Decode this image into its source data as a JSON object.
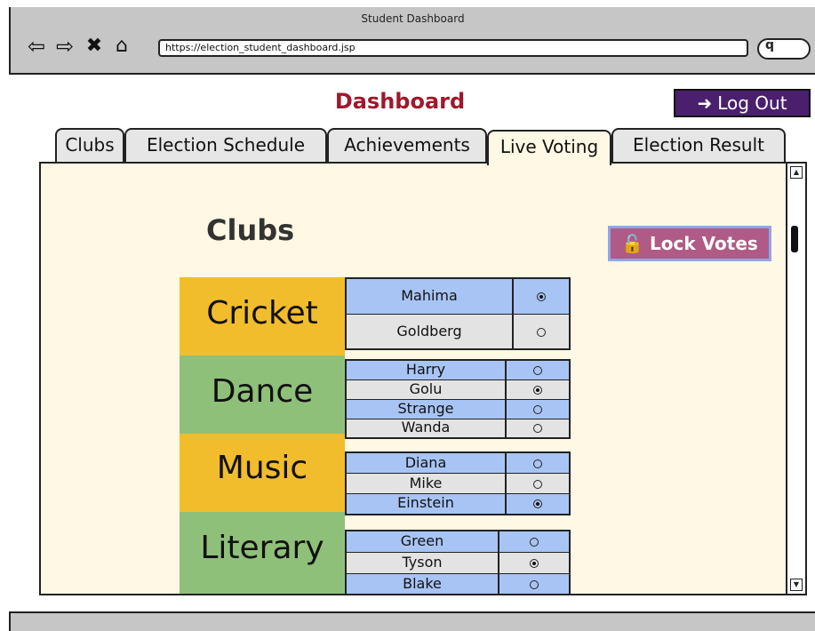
{
  "window": {
    "title": "Student Dashboard",
    "url": "https://election_student_dashboard.jsp"
  },
  "header": {
    "title": "Dashboard",
    "logout_label": "Log Out"
  },
  "tabs": [
    {
      "label": "Clubs"
    },
    {
      "label": "Election Schedule"
    },
    {
      "label": "Achievements"
    },
    {
      "label": "Live Voting",
      "active": true
    },
    {
      "label": "Election Result"
    }
  ],
  "main": {
    "section_title": "Clubs",
    "lock_label": "Lock Votes",
    "clubs": [
      {
        "name": "Cricket",
        "color": "#f2bd2c",
        "candidates": [
          {
            "name": "Mahima",
            "selected": true
          },
          {
            "name": "Goldberg",
            "selected": false
          }
        ]
      },
      {
        "name": "Dance",
        "color": "#8fc07a",
        "candidates": [
          {
            "name": "Harry",
            "selected": false
          },
          {
            "name": "Golu",
            "selected": true
          },
          {
            "name": "Strange",
            "selected": false
          },
          {
            "name": "Wanda",
            "selected": false
          }
        ]
      },
      {
        "name": "Music",
        "color": "#f2bd2c",
        "candidates": [
          {
            "name": "Diana",
            "selected": false
          },
          {
            "name": "Mike",
            "selected": false
          },
          {
            "name": "Einstein",
            "selected": true
          }
        ]
      },
      {
        "name": "Literary",
        "color": "#8fc07a",
        "candidates": [
          {
            "name": "Green",
            "selected": false
          },
          {
            "name": "Tyson",
            "selected": true
          },
          {
            "name": "Blake",
            "selected": false
          }
        ]
      }
    ]
  },
  "colors": {
    "title": "#a0182a",
    "logout_bg": "#4a1f6e",
    "lock_bg": "#b05a86",
    "panel_bg": "#fff8e4"
  }
}
